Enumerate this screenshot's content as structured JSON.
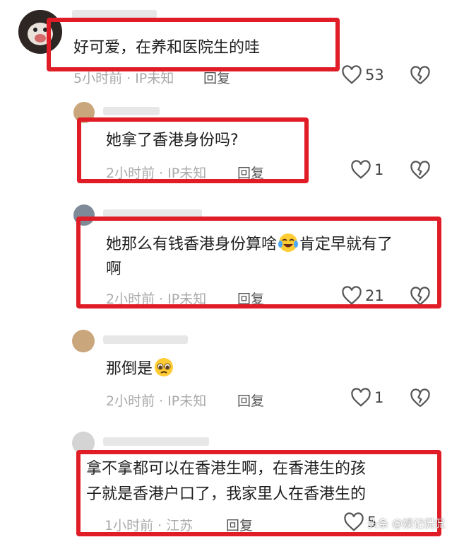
{
  "comments": [
    {
      "text": "好可爱，在养和医院生的哇",
      "meta": "5小时前 · IP未知",
      "reply_label": "回复",
      "likes": "53"
    },
    {
      "text": "她拿了香港身份吗?",
      "meta": "2小时前 · IP未知",
      "reply_label": "回复",
      "likes": "1"
    },
    {
      "text_line1": "她那么有钱香港身份算啥",
      "text_line1_tail": "肯定早就有了",
      "text_line2": "啊",
      "emoji": "tears-of-joy-emoji",
      "meta": "2小时前 · IP未知",
      "reply_label": "回复",
      "likes": "21"
    },
    {
      "text": "那倒是",
      "emoji": "pleading-face-emoji",
      "meta": "2小时前 · IP未知",
      "reply_label": "回复",
      "likes": "1"
    },
    {
      "text_line1": "拿不拿都可以在香港生啊，在香港生的孩",
      "text_line2": "子就是香港户口了，我家里人在香港生的",
      "meta": "1小时前 · 江苏",
      "reply_label": "回复",
      "likes": "5"
    }
  ],
  "watermark": "头条 @娱记侃侃",
  "colors": {
    "highlight_box": "#e01d26",
    "meta_text": "#a9a9a9"
  },
  "icons": {
    "like": "heart-outline-icon",
    "dislike": "broken-heart-icon"
  }
}
